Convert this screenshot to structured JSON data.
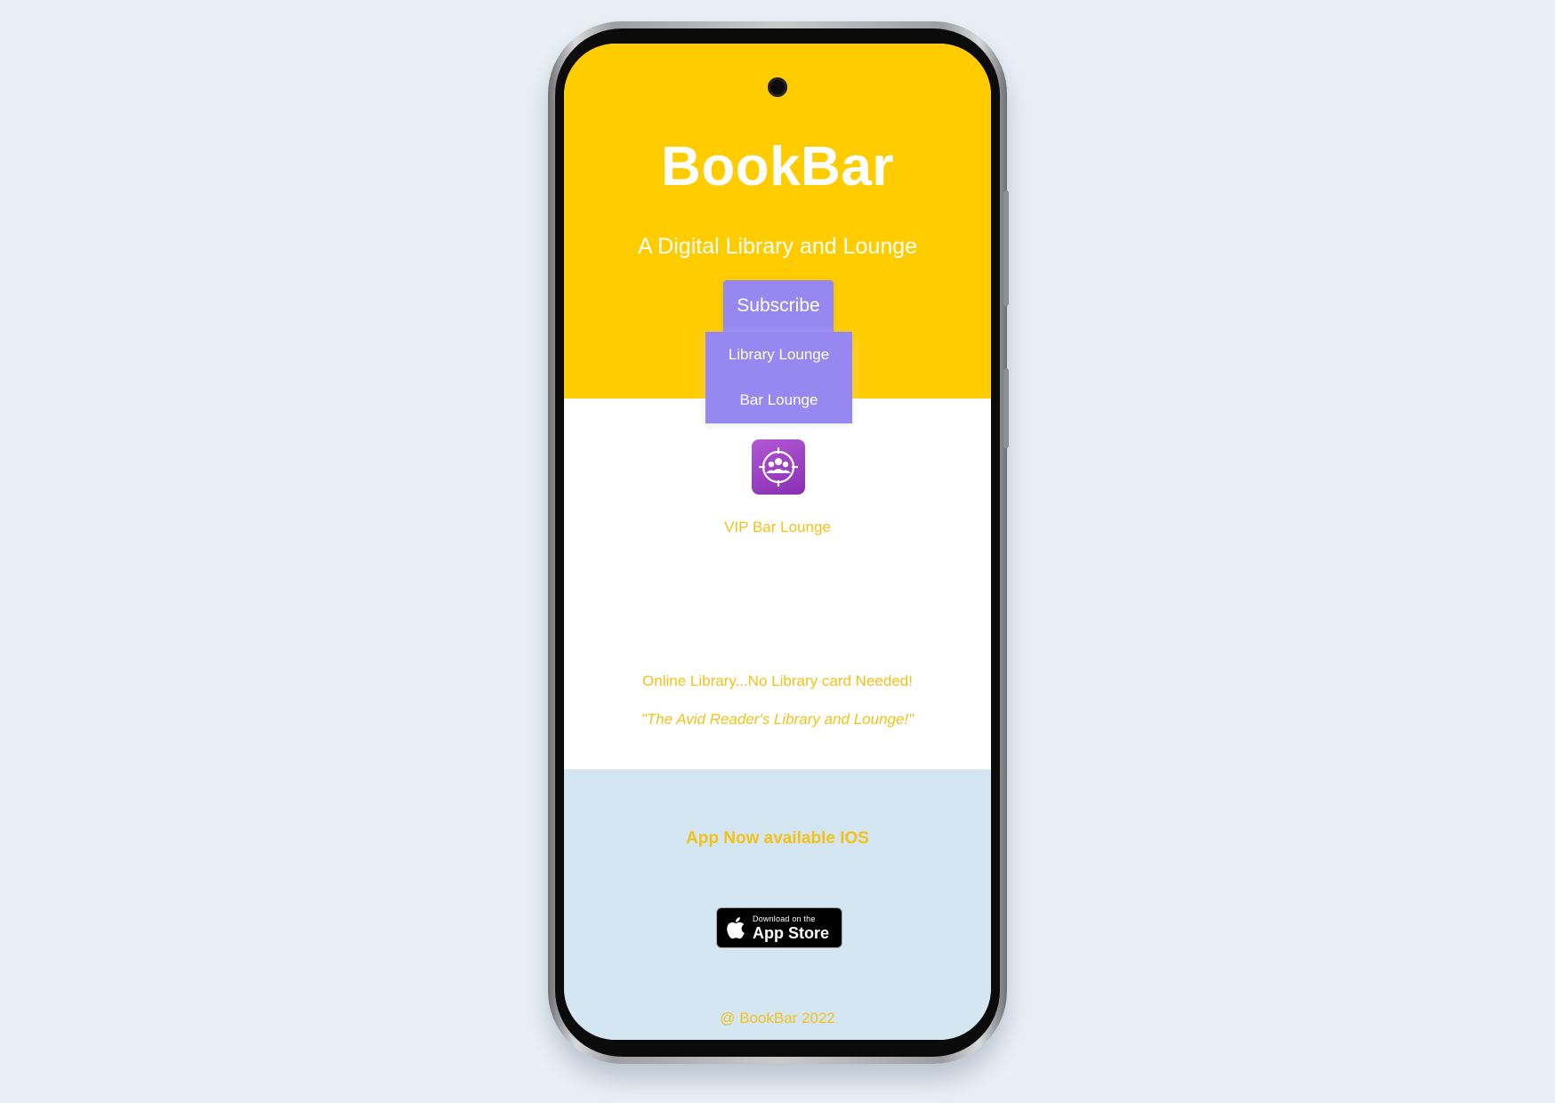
{
  "app": {
    "title": "BookBar",
    "tagline": "A Digital Library and Lounge"
  },
  "nav": {
    "subscribe_label": "Subscribe",
    "dropdown": [
      {
        "label": "Library Lounge"
      },
      {
        "label": "Bar Lounge"
      }
    ]
  },
  "vip": {
    "icon": "group-target-icon",
    "label": "VIP Bar Lounge"
  },
  "content": {
    "online_text": "Online Library...No Library card Needed!",
    "quote": "\"The Avid Reader's Library and Lounge!\""
  },
  "footer": {
    "app_available": "App Now available IOS",
    "appstore_small": "Download on the",
    "appstore_big": "App Store",
    "copyright": "@ BookBar 2022"
  },
  "colors": {
    "hero_bg": "#ffcc00",
    "accent_text": "#f2c21a",
    "menu_bg": "#9688f0",
    "footer_bg": "#d4e6f1",
    "vip_icon_bg": "#9b3fc4"
  }
}
